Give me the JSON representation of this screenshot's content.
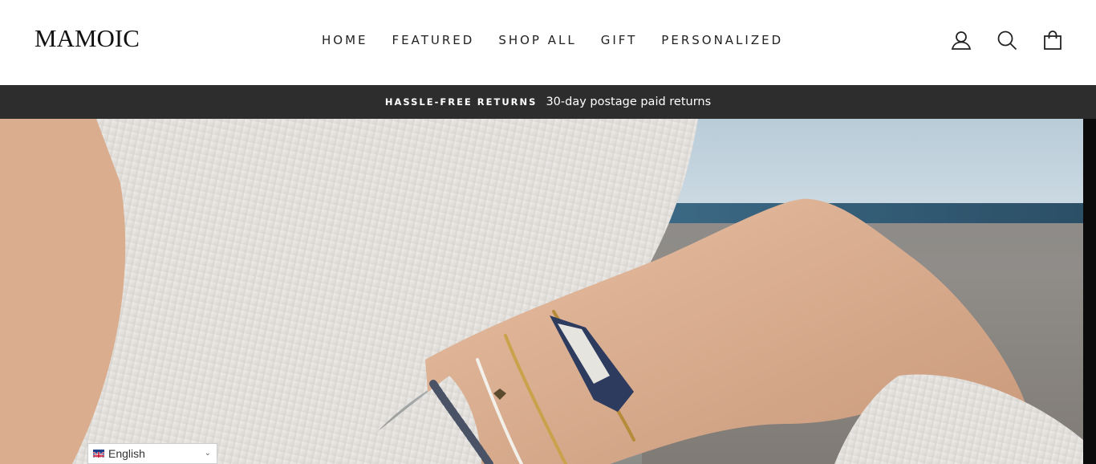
{
  "brand": {
    "logo": "MAMOIC"
  },
  "nav": {
    "items": [
      {
        "label": "HOME"
      },
      {
        "label": "FEATURED"
      },
      {
        "label": "SHOP ALL"
      },
      {
        "label": "GIFT"
      },
      {
        "label": "PERSONALIZED"
      }
    ]
  },
  "header_icons": [
    "user-icon",
    "search-icon",
    "cart-icon"
  ],
  "announcement": {
    "strong": "HASSLE-FREE RETURNS",
    "message": "30-day postage paid returns",
    "bg_color": "#2d2d2d"
  },
  "hero": {
    "image": "Woman in white ribbed sweater wearing beaded friendship bracelets"
  },
  "language_selector": {
    "selected": "English"
  }
}
